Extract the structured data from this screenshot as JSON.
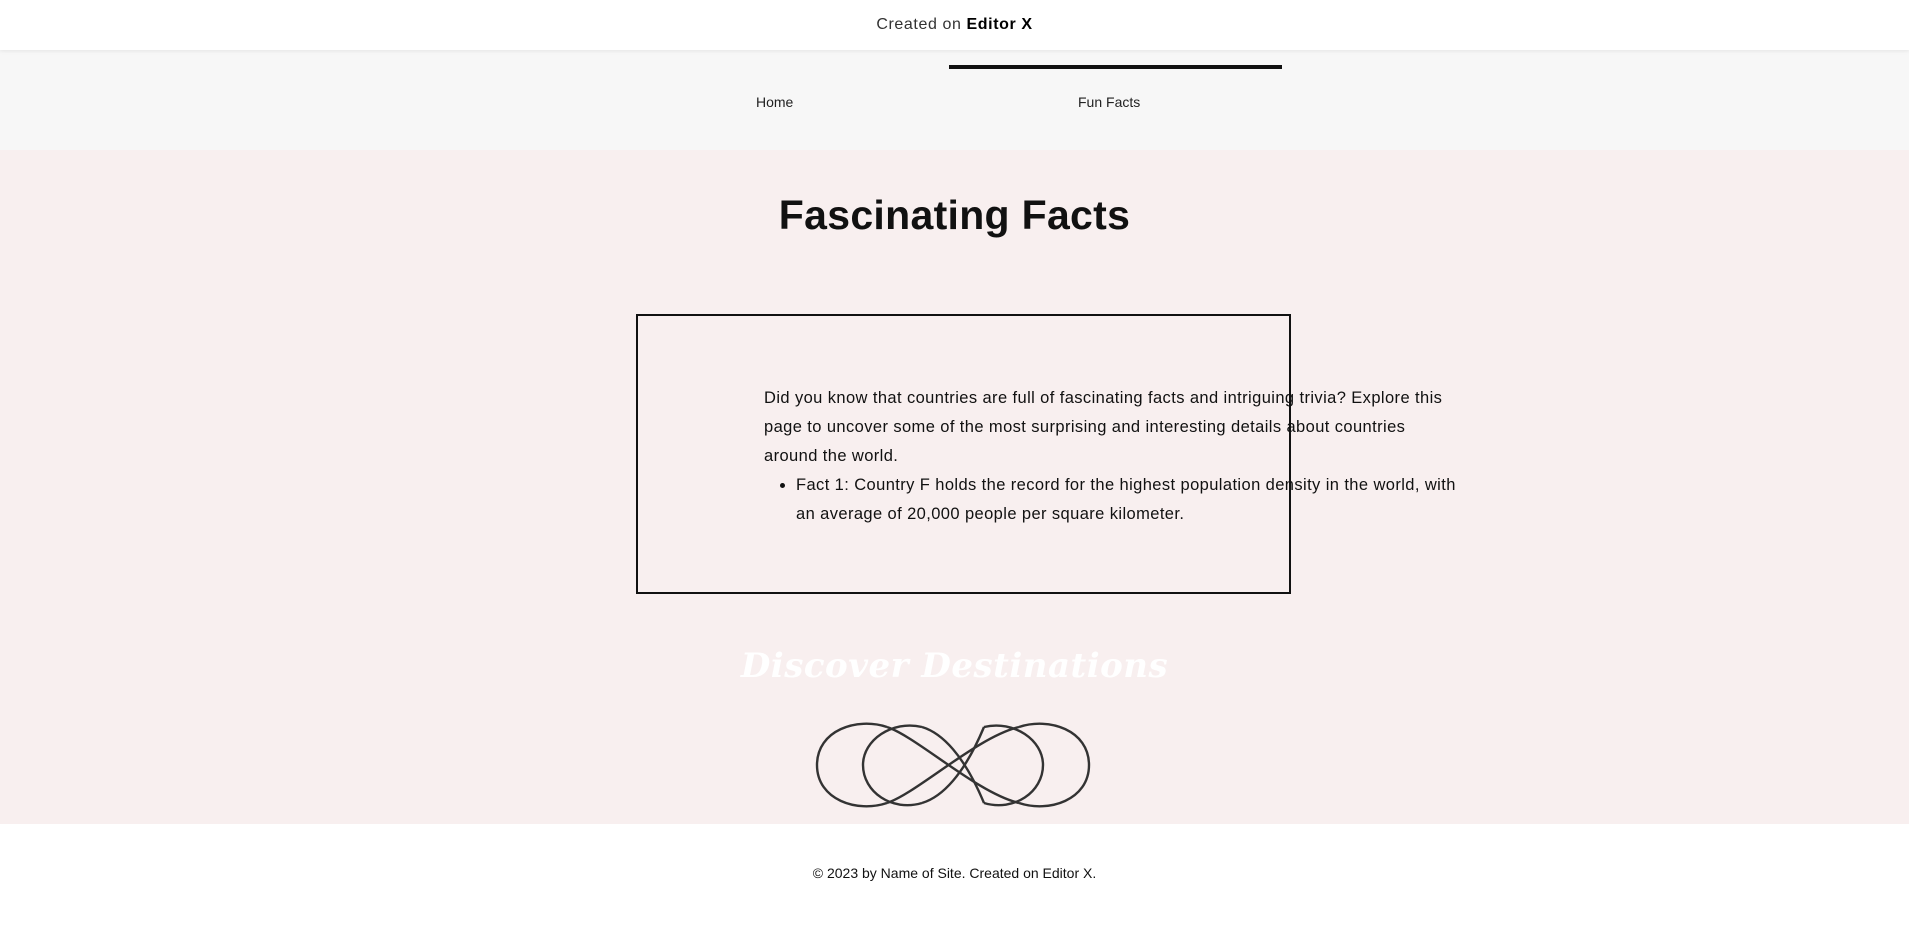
{
  "topbar": {
    "prefix": "Created on",
    "brand": "Editor X"
  },
  "nav": {
    "tabs": [
      {
        "label": "Home",
        "active": false
      },
      {
        "label": "Fun Facts",
        "active": true
      }
    ]
  },
  "main": {
    "title": "Fascinating Facts",
    "intro": "Did you know that countries are full of fascinating facts and intriguing trivia? Explore this page to uncover some of the most surprising and interesting details about countries around the world.",
    "facts": [
      "Fact 1: Country F holds the record for the highest population density in the world, with an average of 20,000 people per square kilometer."
    ],
    "discover": "Discover Destinations"
  },
  "footer": {
    "copyright": "© 2023 by Name of Site. Created on Editor X."
  },
  "colors": {
    "main_bg": "#f8efef",
    "nav_bg": "#f7f7f7",
    "knot_stroke": "#333333"
  }
}
